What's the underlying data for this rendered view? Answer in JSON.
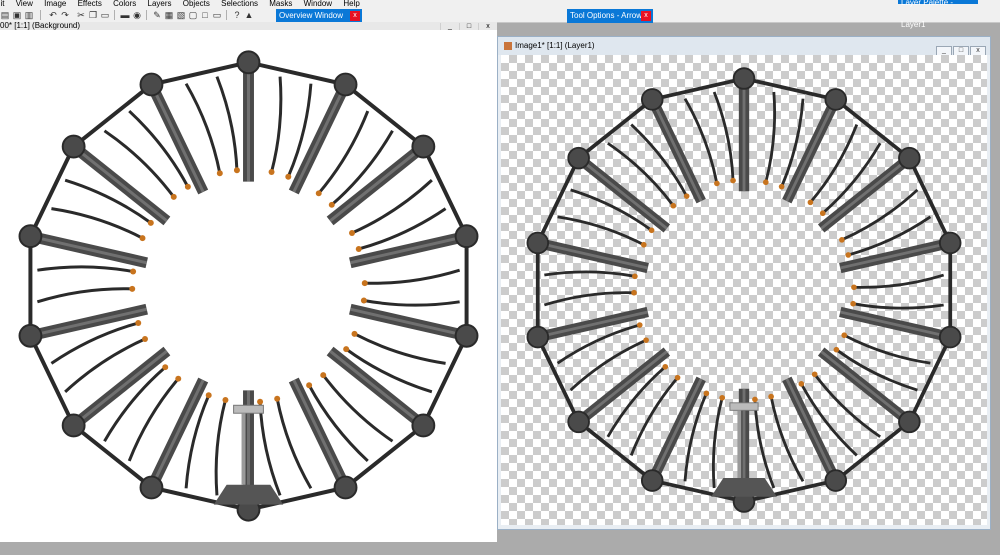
{
  "menubar": {
    "items": [
      {
        "label": "dit"
      },
      {
        "label": "View"
      },
      {
        "label": "Image"
      },
      {
        "label": "Effects"
      },
      {
        "label": "Colors"
      },
      {
        "label": "Layers"
      },
      {
        "label": "Objects"
      },
      {
        "label": "Selections"
      },
      {
        "label": "Masks"
      },
      {
        "label": "Window"
      },
      {
        "label": "Help"
      }
    ]
  },
  "toolbar": {
    "icons": [
      "open-icon",
      "save-icon",
      "print-icon",
      "undo-icon",
      "redo-icon",
      "cut-icon",
      "copy-icon",
      "paste-icon",
      "scanner-icon",
      "browse-icon",
      "brush-icon",
      "image-icon",
      "layers-icon",
      "frame-icon",
      "fullscreen-icon",
      "help-icon",
      "hand-icon"
    ]
  },
  "floating_toolbars": {
    "overview": {
      "title": "Overview Window",
      "close": "x"
    },
    "tool_options": {
      "title": "Tool Options - Arrow",
      "close": "x"
    },
    "layer_palette": {
      "title": "Layer Palette - Layer1"
    }
  },
  "left_window": {
    "title": "00* [1:1] (Background)",
    "buttons": {
      "minimize": "_",
      "maximize": "□",
      "close": "x"
    }
  },
  "right_window": {
    "title": "Image1* [1:1] (Layer1)",
    "buttons": {
      "minimize": "_",
      "maximize": "□",
      "close": "x"
    }
  },
  "colors": {
    "titlebar_active": "#0a78d7",
    "close_red": "#e81123",
    "canvas_white": "#ffffff",
    "checker_gray": "#cccccc",
    "tube_dark": "#4a4a4a",
    "tube_light": "#8a8a8a",
    "ring_dark": "#2a2a2a",
    "cable_tip_orange": "#c8741e",
    "workspace_gray": "#ababab"
  }
}
